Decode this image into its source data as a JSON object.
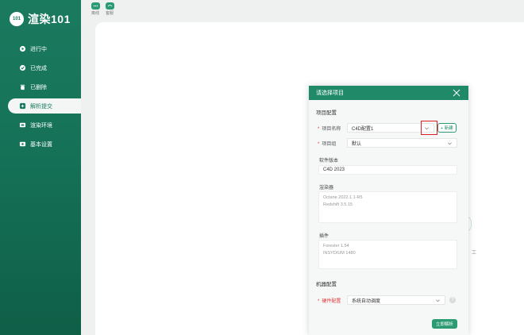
{
  "app": {
    "logo_badge": "101",
    "logo_text": "渲染101"
  },
  "sidebar": {
    "items": [
      {
        "label": "进行中",
        "icon": "running-icon",
        "active": false
      },
      {
        "label": "已完成",
        "icon": "completed-icon",
        "active": false
      },
      {
        "label": "已删除",
        "icon": "trash-icon",
        "active": false
      },
      {
        "label": "解析提交",
        "icon": "parse-submit-icon",
        "active": true
      },
      {
        "label": "渲染环境",
        "icon": "render-env-icon",
        "active": false
      },
      {
        "label": "基本设置",
        "icon": "settings-icon",
        "active": false
      }
    ]
  },
  "topbar": {
    "buttons": [
      {
        "label": "离线",
        "icon": "chat-icon"
      },
      {
        "label": "客服",
        "icon": "support-icon"
      }
    ]
  },
  "main": {
    "ghost_char": "工"
  },
  "dialog": {
    "title": "请选择项目",
    "project_section": "项目配置",
    "project_name_label": "项目名称",
    "project_name_value": "C4D配置1",
    "new_button": "+ 新建",
    "project_group_label": "项目组",
    "project_group_value": "默认",
    "software_version_label": "软件版本",
    "software_version_value": "C4D 2023",
    "renderer_label": "渲染器",
    "renderer_lines": [
      "Octane 2022.1.1-R5",
      "Redshift 3.5.15"
    ],
    "plugins_label": "插件",
    "plugin_lines": [
      "Forester 1.54",
      "INSYDIUM 1480"
    ],
    "machine_section": "机器配置",
    "hardware_label": "硬件配置",
    "hardware_value": "系统自动调度",
    "help": "?",
    "submit_label": "立即解析"
  },
  "colors": {
    "brand": "#1a7a5e",
    "accent": "#2a9b73",
    "required": "#e03a3a",
    "highlight": "#e02020"
  }
}
